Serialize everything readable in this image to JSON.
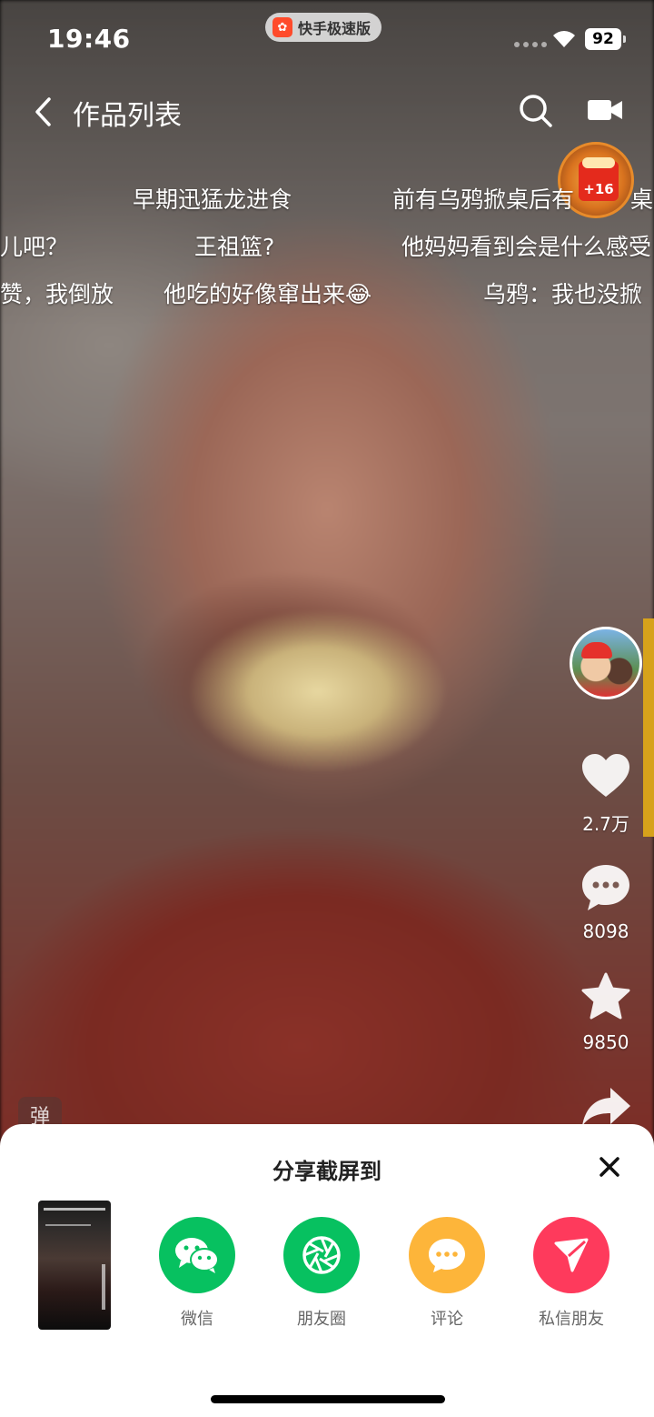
{
  "status_bar": {
    "time": "19:46",
    "app_name": "快手极速版",
    "battery": "92"
  },
  "header": {
    "title": "作品列表"
  },
  "red_packet": {
    "bonus": "+16"
  },
  "danmaku": [
    "早期迅猛龙进食",
    "前有乌鸦掀桌后有",
    "桌",
    "儿吧？",
    "王祖篮?",
    "他妈妈看到会是什么感受",
    "赞，我倒放",
    "他吃的好像窜出来😂",
    "乌鸦：我也没掀"
  ],
  "actions": {
    "likes": "2.7万",
    "comments": "8098",
    "favorites": "9850"
  },
  "danmu_toggle": "弹",
  "share_sheet": {
    "title": "分享截屏到",
    "options": [
      {
        "label": "微信",
        "color": "#07c160"
      },
      {
        "label": "朋友圈",
        "color": "#07c160"
      },
      {
        "label": "评论",
        "color": "#fdb53a"
      },
      {
        "label": "私信朋友",
        "color": "#fe3a5c"
      }
    ]
  }
}
